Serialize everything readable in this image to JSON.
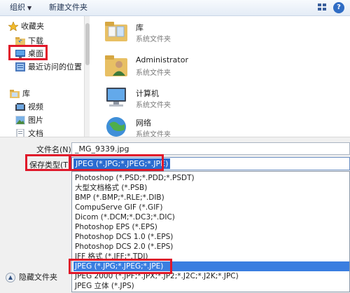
{
  "toolbar": {
    "organize_label": "组织",
    "new_folder_label": "新建文件夹"
  },
  "nav": {
    "items": [
      {
        "label": "收藏夹",
        "icon": "star-icon"
      },
      {
        "label": "下载",
        "icon": "download-folder-icon"
      },
      {
        "label": "桌面",
        "icon": "desktop-icon"
      },
      {
        "label": "最近访问的位置",
        "icon": "recent-places-icon"
      },
      {
        "label": "库",
        "icon": "library-icon"
      },
      {
        "label": "视频",
        "icon": "video-icon"
      },
      {
        "label": "图片",
        "icon": "pictures-icon"
      },
      {
        "label": "文档",
        "icon": "documents-icon"
      }
    ]
  },
  "files": [
    {
      "name": "库",
      "type": "系统文件夹",
      "icon": "library-folder-icon"
    },
    {
      "name": "Administrator",
      "type": "系统文件夹",
      "icon": "user-folder-icon"
    },
    {
      "name": "计算机",
      "type": "系统文件夹",
      "icon": "computer-icon"
    },
    {
      "name": "网络",
      "type": "系统文件夹",
      "icon": "network-icon"
    }
  ],
  "form": {
    "filename_label": "文件名(N):",
    "filename_value": "_MG_9339.jpg",
    "savetype_label": "保存类型(T):",
    "savetype_value": "JPEG (*.JPG;*.JPEG;*.JPE)",
    "hide_folders_label": "隐藏文件夹"
  },
  "dropdown_options": [
    "Photoshop (*.PSD;*.PDD;*.PSDT)",
    "大型文档格式 (*.PSB)",
    "BMP (*.BMP;*.RLE;*.DIB)",
    "CompuServe GIF (*.GIF)",
    "Dicom (*.DCM;*.DC3;*.DIC)",
    "Photoshop EPS (*.EPS)",
    "Photoshop DCS 1.0 (*.EPS)",
    "Photoshop DCS 2.0 (*.EPS)",
    "IFF 格式 (*.IFF;*.TDI)",
    "JPEG (*.JPG;*.JPEG;*.JPE)",
    "JPEG 2000 (*.JPF;*.JPX;*.JP2;*.J2C;*.J2K;*.JPC)",
    "JPEG 立体 (*.JPS)"
  ],
  "dropdown_selected_index": 9,
  "colors": {
    "highlight": "#e0182a",
    "selection": "#3a7ee0"
  }
}
